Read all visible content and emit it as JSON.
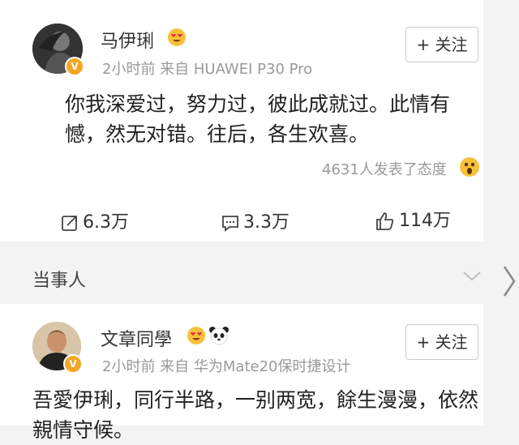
{
  "post1": {
    "author": "马伊琍",
    "meta": "2小时前  来自 HUAWEI P30 Pro",
    "follow_label": "+ 关注",
    "text": "你我深爱过，努力过，彼此成就过。此情有憾，然无对错。往后，各生欢喜。",
    "reactions": "4631人发表了态度",
    "repost_count": "6.3万",
    "comment_count": "3.3万",
    "like_count": "114万",
    "verified_badge": "V"
  },
  "section": {
    "title": "当事人"
  },
  "post2": {
    "author": "文章同學",
    "meta": "2小时前  来自 华为Mate20保时捷设计",
    "follow_label": "+ 关注",
    "text": "吾愛伊琍，同行半路，一别两宽，餘生漫漫，依然親情守候。",
    "verified_badge": "V"
  },
  "colors": {
    "badge": "#f5a623",
    "text_secondary": "#999999"
  }
}
